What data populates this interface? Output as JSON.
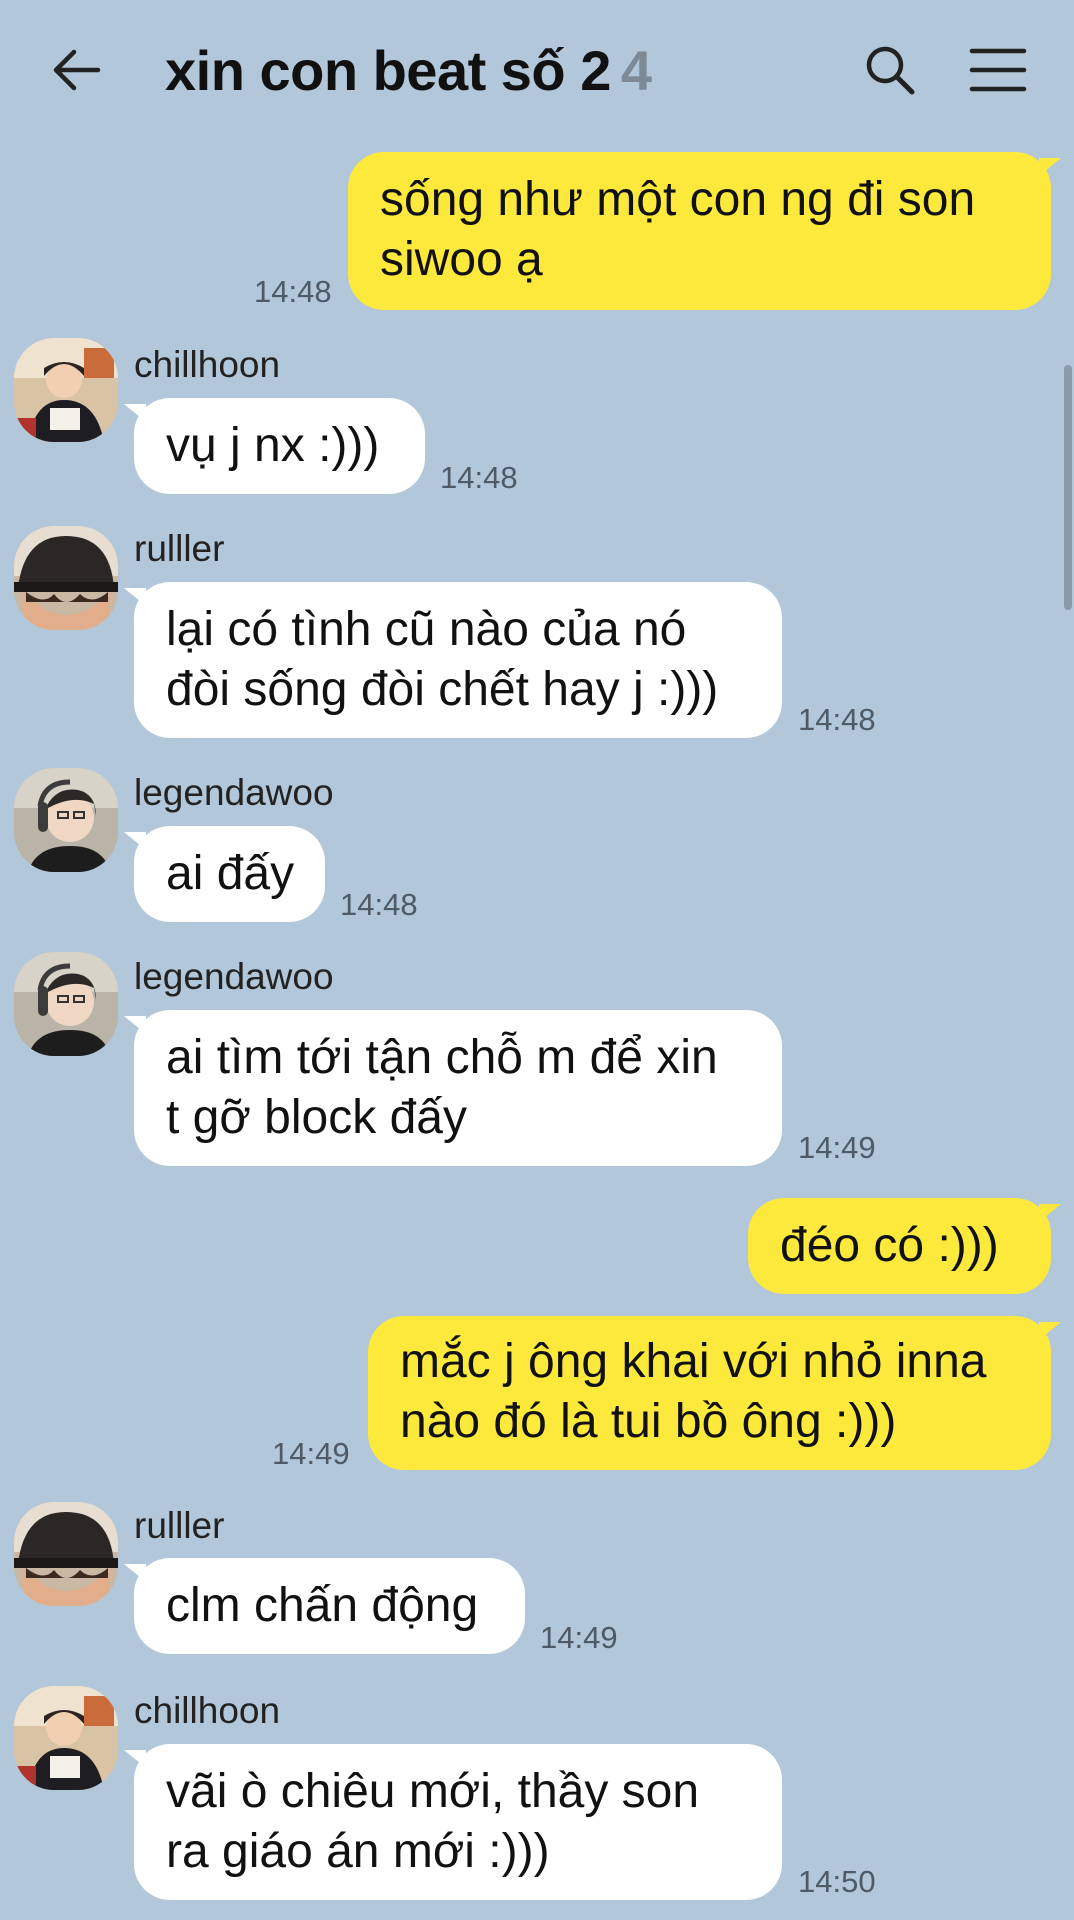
{
  "header": {
    "title": "xin con beat số 2",
    "member_count": "4",
    "icons": [
      "back-arrow-icon",
      "search-icon",
      "menu-icon"
    ]
  },
  "colors": {
    "background": "#b2c7d9",
    "incoming_bubble": "#ffffff",
    "outgoing_bubble": "#fde93c"
  },
  "messages": [
    {
      "direction": "out",
      "lines": [
        "sống như một con ng đi son",
        "siwoo ạ"
      ],
      "time": "14:48"
    },
    {
      "direction": "in",
      "sender": "chillhoon",
      "lines": [
        "vụ j nx :)))"
      ],
      "time": "14:48"
    },
    {
      "direction": "in",
      "sender": "rulller",
      "lines": [
        "lại có tình cũ nào của nó",
        "đòi sống đòi chết hay j :)))"
      ],
      "time": "14:48"
    },
    {
      "direction": "in",
      "sender": "legendawoo",
      "lines": [
        "ai đấy"
      ],
      "time": "14:48"
    },
    {
      "direction": "in",
      "sender": "legendawoo",
      "lines": [
        "ai tìm tới tận chỗ m để xin",
        "t gỡ block đấy"
      ],
      "time": "14:49"
    },
    {
      "direction": "out",
      "lines": [
        "đéo có :)))"
      ],
      "time": ""
    },
    {
      "direction": "out",
      "lines": [
        "mắc j ông khai với nhỏ inna",
        "nào đó là tui bồ ông :)))"
      ],
      "time": "14:49"
    },
    {
      "direction": "in",
      "sender": "rulller",
      "lines": [
        "clm chấn động"
      ],
      "time": "14:49"
    },
    {
      "direction": "in",
      "sender": "chillhoon",
      "lines": [
        "vãi ò chiêu mới, thầy son",
        "ra giáo án mới :)))"
      ],
      "time": "14:50"
    }
  ]
}
